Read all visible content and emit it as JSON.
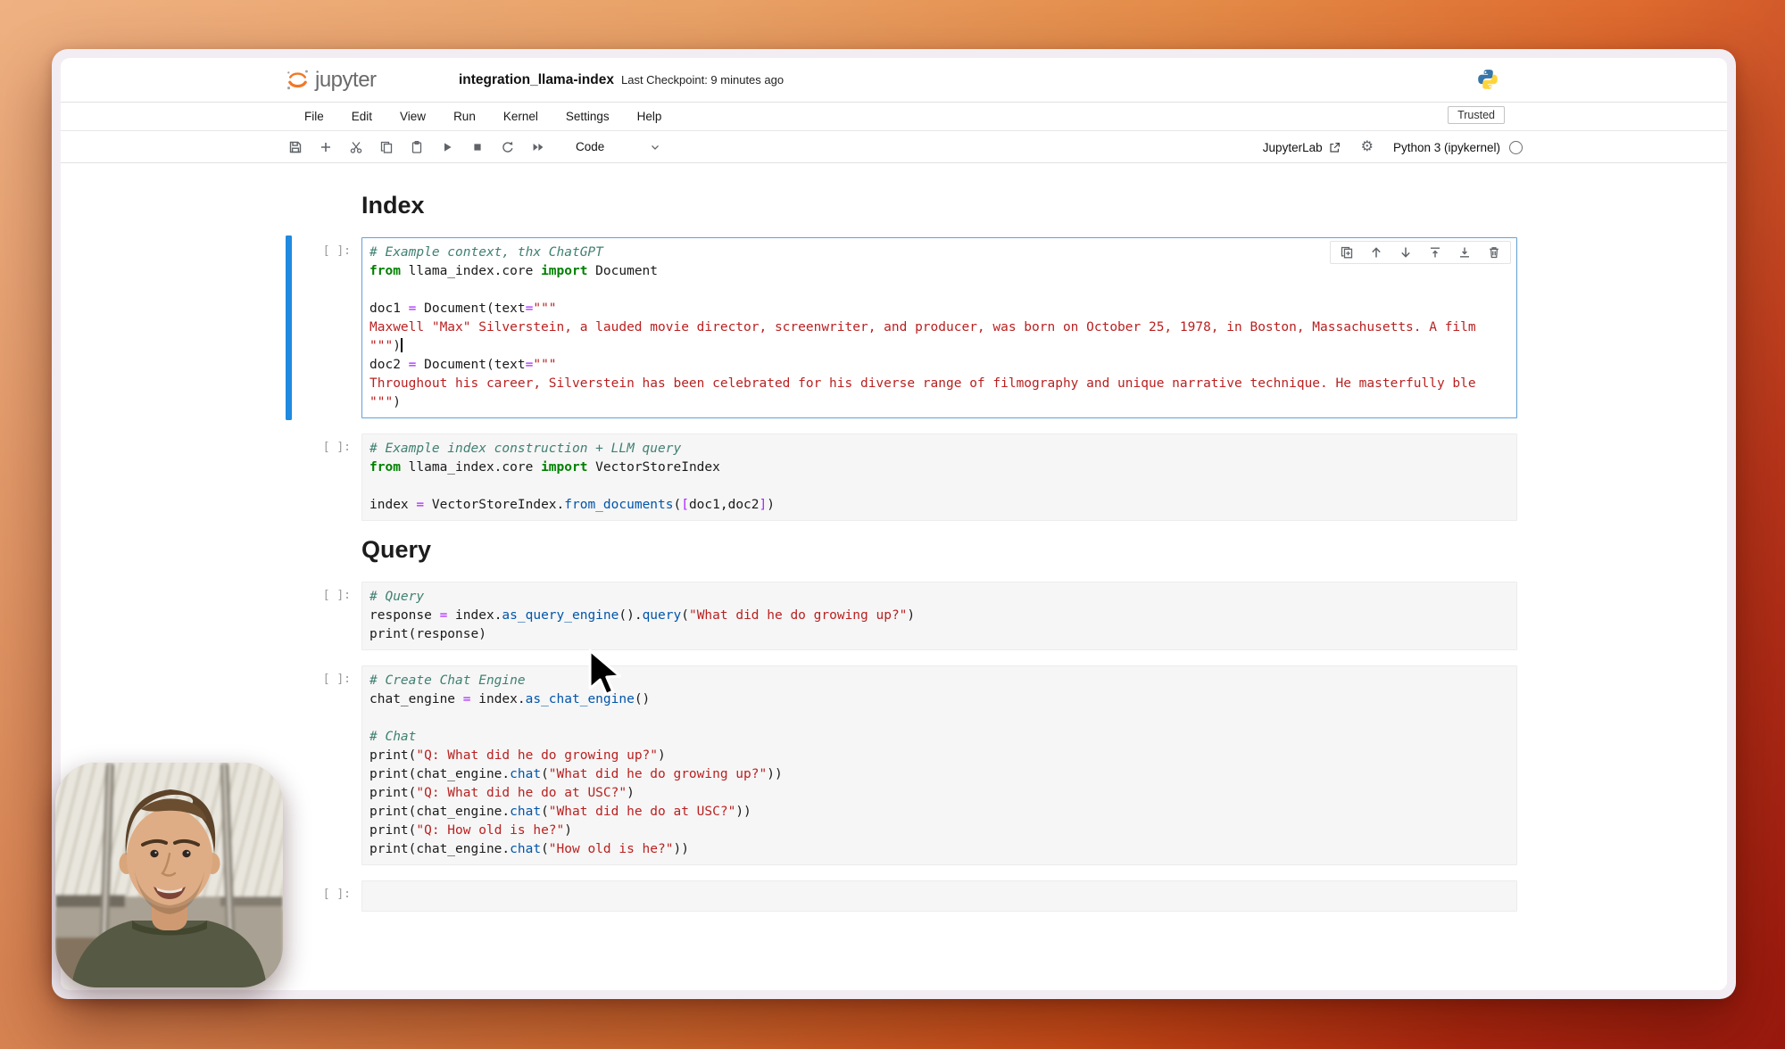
{
  "colors": {
    "jupyter_orange": "#f37726",
    "selected_cell_border": "#5ea2dc",
    "selected_cell_bar": "#1f8ae0",
    "code_comment": "#408072",
    "code_keyword": "#008000",
    "code_string": "#ba2121",
    "code_operator": "#aa22ff",
    "code_function": "#0055aa",
    "python_blue": "#3776ab",
    "python_yellow": "#ffd43b",
    "desktop_top": "#edab7a",
    "desktop_bottom": "#9c1c10"
  },
  "header": {
    "logo_text": "jupyter",
    "title": "integration_llama-index",
    "checkpoint": "Last Checkpoint: 9 minutes ago"
  },
  "menubar": {
    "items": [
      "File",
      "Edit",
      "View",
      "Run",
      "Kernel",
      "Settings",
      "Help"
    ],
    "trusted": "Trusted"
  },
  "toolbar": {
    "left_icons": [
      "save-icon",
      "add-cell-icon",
      "cut-cells-icon",
      "copy-cells-icon",
      "paste-cells-icon",
      "run-icon",
      "interrupt-icon",
      "restart-kernel-icon",
      "restart-run-all-icon"
    ],
    "cell_type_value": "Code",
    "jupyterlab_link": "JupyterLab",
    "kernel_name": "Python 3 (ipykernel)"
  },
  "notebook": {
    "cell_toolbar_icons": [
      "duplicate-cell-icon",
      "move-cell-up-icon",
      "move-cell-down-icon",
      "insert-cell-above-icon",
      "insert-cell-below-icon",
      "delete-cell-icon"
    ],
    "items": [
      {
        "type": "heading",
        "text": "Index"
      },
      {
        "type": "code",
        "prompt": "[ ]:",
        "selected": true,
        "toolbar": true,
        "lines": [
          [
            {
              "c": "com",
              "s": "# Example context, thx ChatGPT"
            }
          ],
          [
            {
              "c": "kw",
              "s": "from"
            },
            {
              "c": "pl",
              "s": " llama_index.core "
            },
            {
              "c": "kw",
              "s": "import"
            },
            {
              "c": "pl",
              "s": " Document"
            }
          ],
          [],
          [
            {
              "c": "pl",
              "s": "doc1 "
            },
            {
              "c": "op",
              "s": "="
            },
            {
              "c": "pl",
              "s": " Document(text"
            },
            {
              "c": "op",
              "s": "="
            },
            {
              "c": "str",
              "s": "\"\"\""
            }
          ],
          [
            {
              "c": "str",
              "s": "Maxwell \"Max\" Silverstein, a lauded movie director, screenwriter, and producer, was born on October 25, 1978, in Boston, Massachusetts. A film"
            }
          ],
          [
            {
              "c": "str",
              "s": "\"\"\""
            },
            {
              "c": "pl",
              "s": ")"
            },
            {
              "caret": true
            }
          ],
          [
            {
              "c": "pl",
              "s": "doc2 "
            },
            {
              "c": "op",
              "s": "="
            },
            {
              "c": "pl",
              "s": " Document(text"
            },
            {
              "c": "op",
              "s": "="
            },
            {
              "c": "str",
              "s": "\"\"\""
            }
          ],
          [
            {
              "c": "str",
              "s": "Throughout his career, Silverstein has been celebrated for his diverse range of filmography and unique narrative technique. He masterfully ble"
            }
          ],
          [
            {
              "c": "str",
              "s": "\"\"\""
            },
            {
              "c": "pl",
              "s": ")"
            }
          ]
        ]
      },
      {
        "type": "code",
        "prompt": "[ ]:",
        "lines": [
          [
            {
              "c": "com",
              "s": "# Example index construction + LLM query"
            }
          ],
          [
            {
              "c": "kw",
              "s": "from"
            },
            {
              "c": "pl",
              "s": " llama_index.core "
            },
            {
              "c": "kw",
              "s": "import"
            },
            {
              "c": "pl",
              "s": " VectorStoreIndex"
            }
          ],
          [],
          [
            {
              "c": "pl",
              "s": "index "
            },
            {
              "c": "op",
              "s": "="
            },
            {
              "c": "pl",
              "s": " VectorStoreIndex."
            },
            {
              "c": "fn",
              "s": "from_documents"
            },
            {
              "c": "pl",
              "s": "("
            },
            {
              "c": "op",
              "s": "["
            },
            {
              "c": "pl",
              "s": "doc1,doc2"
            },
            {
              "c": "op",
              "s": "]"
            },
            {
              "c": "pl",
              "s": ")"
            }
          ]
        ]
      },
      {
        "type": "heading",
        "text": "Query"
      },
      {
        "type": "code",
        "prompt": "[ ]:",
        "lines": [
          [
            {
              "c": "com",
              "s": "# Query"
            }
          ],
          [
            {
              "c": "pl",
              "s": "response "
            },
            {
              "c": "op",
              "s": "="
            },
            {
              "c": "pl",
              "s": " index."
            },
            {
              "c": "fn",
              "s": "as_query_engine"
            },
            {
              "c": "pl",
              "s": "()."
            },
            {
              "c": "fn",
              "s": "query"
            },
            {
              "c": "pl",
              "s": "("
            },
            {
              "c": "str",
              "s": "\"What did he do growing up?\""
            },
            {
              "c": "pl",
              "s": ")"
            }
          ],
          [
            {
              "c": "pl",
              "s": "print(response)"
            }
          ]
        ]
      },
      {
        "type": "code",
        "prompt": "[ ]:",
        "lines": [
          [
            {
              "c": "com",
              "s": "# Create Chat Engine"
            }
          ],
          [
            {
              "c": "pl",
              "s": "chat_engine "
            },
            {
              "c": "op",
              "s": "="
            },
            {
              "c": "pl",
              "s": " index."
            },
            {
              "c": "fn",
              "s": "as_chat_engine"
            },
            {
              "c": "pl",
              "s": "()"
            }
          ],
          [],
          [
            {
              "c": "com",
              "s": "# Chat"
            }
          ],
          [
            {
              "c": "pl",
              "s": "print("
            },
            {
              "c": "str",
              "s": "\"Q: What did he do growing up?\""
            },
            {
              "c": "pl",
              "s": ")"
            }
          ],
          [
            {
              "c": "pl",
              "s": "print(chat_engine."
            },
            {
              "c": "fn",
              "s": "chat"
            },
            {
              "c": "pl",
              "s": "("
            },
            {
              "c": "str",
              "s": "\"What did he do growing up?\""
            },
            {
              "c": "pl",
              "s": "))"
            }
          ],
          [
            {
              "c": "pl",
              "s": "print("
            },
            {
              "c": "str",
              "s": "\"Q: What did he do at USC?\""
            },
            {
              "c": "pl",
              "s": ")"
            }
          ],
          [
            {
              "c": "pl",
              "s": "print(chat_engine."
            },
            {
              "c": "fn",
              "s": "chat"
            },
            {
              "c": "pl",
              "s": "("
            },
            {
              "c": "str",
              "s": "\"What did he do at USC?\""
            },
            {
              "c": "pl",
              "s": "))"
            }
          ],
          [
            {
              "c": "pl",
              "s": "print("
            },
            {
              "c": "str",
              "s": "\"Q: How old is he?\""
            },
            {
              "c": "pl",
              "s": ")"
            }
          ],
          [
            {
              "c": "pl",
              "s": "print(chat_engine."
            },
            {
              "c": "fn",
              "s": "chat"
            },
            {
              "c": "pl",
              "s": "("
            },
            {
              "c": "str",
              "s": "\"How old is he?\""
            },
            {
              "c": "pl",
              "s": "))"
            }
          ]
        ]
      },
      {
        "type": "code",
        "prompt": "[ ]:",
        "lines": []
      }
    ]
  }
}
